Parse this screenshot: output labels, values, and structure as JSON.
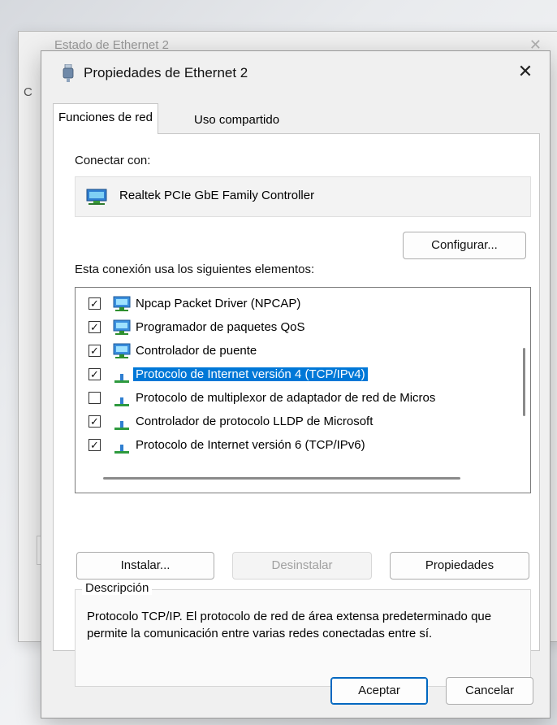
{
  "background_window": {
    "title": "Estado de Ethernet 2",
    "partial_letter": "C"
  },
  "dialog": {
    "title": "Propiedades de Ethernet 2",
    "close_glyph": "✕",
    "tabs": [
      {
        "label": "Funciones de red",
        "active": true
      },
      {
        "label": "Uso compartido",
        "active": false
      }
    ],
    "connect_label": "Conectar con:",
    "adapter_name": "Realtek PCIe GbE Family Controller",
    "configure_button": "Configurar...",
    "list_label": "Esta conexión usa los siguientes elementos:",
    "items": [
      {
        "label": "Npcap Packet Driver (NPCAP)",
        "checked": true,
        "icon": "network-client-icon",
        "check_glyph": "✓"
      },
      {
        "label": "Programador de paquetes QoS",
        "checked": true,
        "icon": "network-service-icon",
        "check_glyph": "✓"
      },
      {
        "label": "Controlador de puente",
        "checked": true,
        "icon": "network-service-icon",
        "check_glyph": "✓"
      },
      {
        "label": "Protocolo de Internet versión 4 (TCP/IPv4)",
        "checked": true,
        "icon": "protocol-icon",
        "selected": true,
        "check_glyph": "✓"
      },
      {
        "label": "Protocolo de multiplexor de adaptador de red de Micros",
        "checked": false,
        "icon": "protocol-icon",
        "check_glyph": ""
      },
      {
        "label": "Controlador de protocolo LLDP de Microsoft",
        "checked": true,
        "icon": "protocol-icon",
        "check_glyph": "✓"
      },
      {
        "label": "Protocolo de Internet versión 6 (TCP/IPv6)",
        "checked": true,
        "icon": "protocol-icon",
        "check_glyph": "✓"
      }
    ],
    "buttons": {
      "install": "Instalar...",
      "uninstall": "Desinstalar",
      "properties": "Propiedades"
    },
    "description": {
      "title": "Descripción",
      "text": "Protocolo TCP/IP. El protocolo de red de área extensa predeterminado que permite la comunicación entre varias redes conectadas entre sí."
    },
    "ok_button": "Aceptar",
    "cancel_button": "Cancelar"
  },
  "colors": {
    "selection": "#0078d7",
    "accent": "#0067c0",
    "dialog_bg": "#f0f0f0"
  }
}
